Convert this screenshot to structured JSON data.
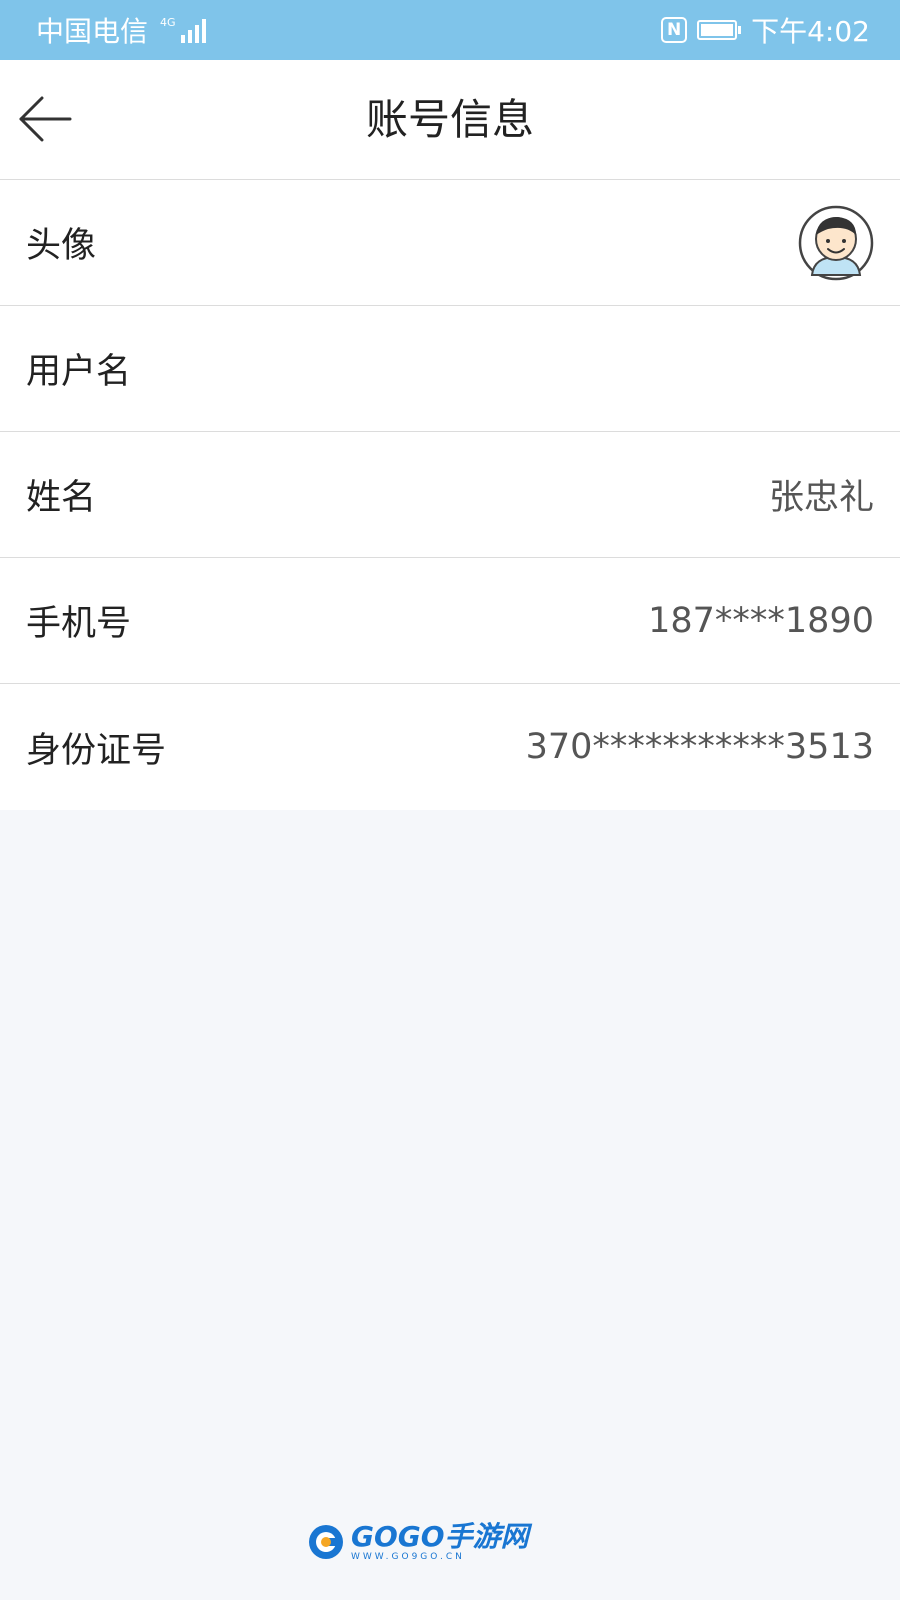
{
  "status_bar": {
    "carrier": "中国电信",
    "network_type": "4G",
    "time": "下午4:02",
    "icons": [
      "signal-icon",
      "nfc-icon",
      "battery-icon"
    ]
  },
  "header": {
    "title": "账号信息",
    "back_icon": "arrow-left-icon"
  },
  "rows": [
    {
      "label": "头像",
      "value": "",
      "icon": "avatar"
    },
    {
      "label": "用户名",
      "value": ""
    },
    {
      "label": "姓名",
      "value": "张忠礼"
    },
    {
      "label": "手机号",
      "value": "187****1890"
    },
    {
      "label": "身份证号",
      "value": "370***********3513"
    }
  ],
  "watermark": {
    "title": "GOGO手游网",
    "url": "WWW.GO9GO.CN"
  },
  "colors": {
    "status_bar": "#7fc4ea",
    "background": "#f5f7fa",
    "divider": "#dcdcdc",
    "watermark": "#1976d2"
  }
}
